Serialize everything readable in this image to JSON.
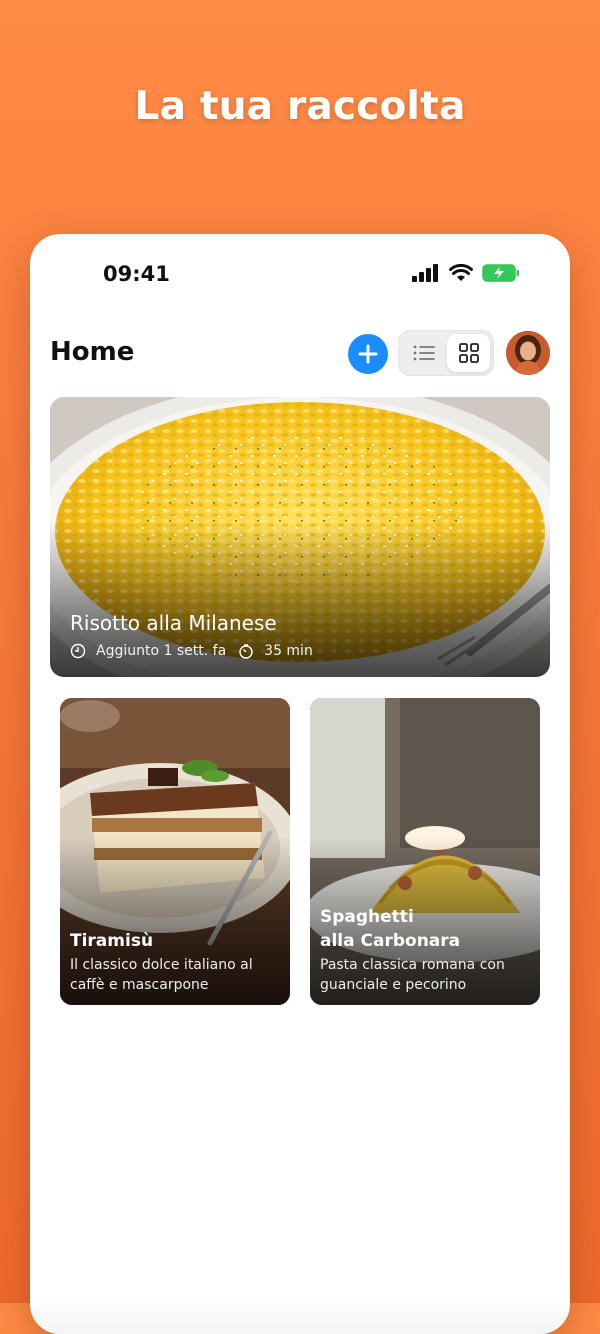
{
  "headline": "La tua raccolta",
  "status_bar": {
    "time": "09:41",
    "icons": [
      "cellular-signal-icon",
      "wifi-icon",
      "battery-charging-icon"
    ]
  },
  "header": {
    "title": "Home",
    "add_icon": "plus-icon",
    "view_modes": [
      {
        "name": "list",
        "icon": "list-icon",
        "selected": false
      },
      {
        "name": "grid",
        "icon": "grid-icon",
        "selected": true
      }
    ]
  },
  "featured": {
    "title": "Risotto alla Milanese",
    "added": "Aggiunto 1 sett. fa",
    "duration": "35 min"
  },
  "cards": [
    {
      "title_line1": "Tiramisù",
      "title_line2": "",
      "description": "Il classico dolce italiano al caffè e mascarpone"
    },
    {
      "title_line1": "Spaghetti",
      "title_line2": "alla Carbonara",
      "description": "Pasta classica romana con guanciale e pecorino"
    }
  ],
  "colors": {
    "background": "#f77a3a",
    "accent": "#1a8cff",
    "battery": "#34c759"
  }
}
